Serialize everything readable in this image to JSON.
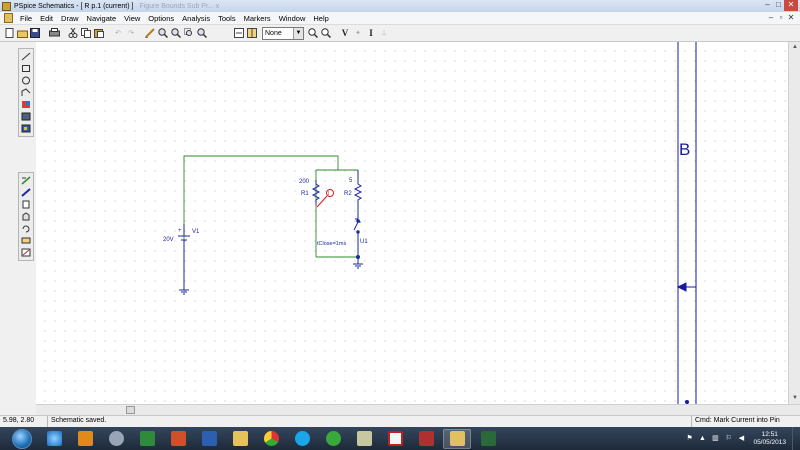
{
  "window": {
    "title": "PSpice Schematics - [ R  p.1 (current) ]",
    "ghost_title": "Figure Bounds Sub Pr...  x",
    "buttons": [
      "–",
      "□",
      "✕"
    ]
  },
  "menu": {
    "items": [
      "File",
      "Edit",
      "Draw",
      "Navigate",
      "View",
      "Options",
      "Analysis",
      "Tools",
      "Markers",
      "Window",
      "Help"
    ],
    "mdi_buttons": [
      "–",
      "▫",
      "✕"
    ]
  },
  "toolbar": {
    "icons": [
      "new-icon",
      "open-icon",
      "save-icon",
      "print-icon",
      "cut-icon",
      "copy-icon",
      "paste-icon",
      "undo-icon",
      "redo-icon",
      "pencil-icon",
      "zoom-in-icon",
      "zoom-out-icon",
      "zoom-area-icon",
      "zoom-fit-icon",
      "redraw-icon",
      "grid-icon",
      "part-browser-icon"
    ],
    "dropdown_value": "None",
    "text_buttons": [
      "V",
      "I"
    ]
  },
  "schematic": {
    "r1_value": "200",
    "r1_label": "R1",
    "r2_value": "5",
    "r2_label": "R2",
    "v1_label": "V1",
    "v1_value": "20V",
    "v1_plus": "+",
    "switch_label": "U1",
    "switch_param": "tClose=1ms",
    "marker_label": "I",
    "border_letter": "B"
  },
  "colors": {
    "wire": "#2f8a2f",
    "part": "#1a2a9a",
    "marker": "#d42020",
    "border": "#1a1aa0"
  },
  "status": {
    "coords": "5.98,  2.80",
    "message": "Schematic saved.",
    "command": "Cmd: Mark Current into Pin"
  },
  "taskbar": {
    "apps": [
      "ie-icon",
      "media-player-icon",
      "wizard-icon",
      "excel-icon",
      "powerpoint-icon",
      "word-icon",
      "folder-icon",
      "chrome-icon",
      "skype-icon",
      "sync-icon",
      "news-icon",
      "acrobat-icon",
      "archive-icon",
      "pspice-icon",
      "probe-icon"
    ],
    "time": "12:51",
    "date": "05/05/2013"
  }
}
